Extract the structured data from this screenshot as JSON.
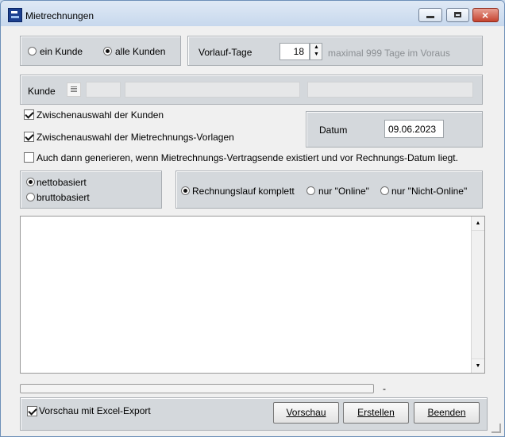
{
  "window": {
    "title": "Mietrechnungen",
    "icon": "app-icon"
  },
  "customers": {
    "option_one": "ein Kunde",
    "option_all": "alle Kunden",
    "selected": "alle Kunden"
  },
  "lead": {
    "label": "Vorlauf-Tage",
    "value": "18",
    "hint": "maximal 999 Tage im Voraus"
  },
  "kunde": {
    "label": "Kunde"
  },
  "options": {
    "select_customers": "Zwischenauswahl der Kunden",
    "select_templates": "Zwischenauswahl der Mietrechnungs-Vorlagen",
    "generate_even": "Auch dann generieren, wenn Mietrechnungs-Vertragsende existiert und vor Rechnungs-Datum liegt."
  },
  "date": {
    "label": "Datum",
    "value": "09.06.2023"
  },
  "basis": {
    "net": "nettobasiert",
    "gross": "bruttobasiert",
    "selected": "nettobasiert"
  },
  "run": {
    "complete": "Rechnungslauf komplett",
    "online": "nur \"Online\"",
    "offline": "nur \"Nicht-Online\"",
    "selected": "Rechnungslauf komplett"
  },
  "status": {
    "progress_text": "-"
  },
  "footer": {
    "preview_excel": "Vorschau mit Excel-Export",
    "preview": "Vorschau",
    "create": "Erstellen",
    "exit": "Beenden"
  },
  "scrollbar": {
    "up": "▲",
    "down": "▼"
  }
}
